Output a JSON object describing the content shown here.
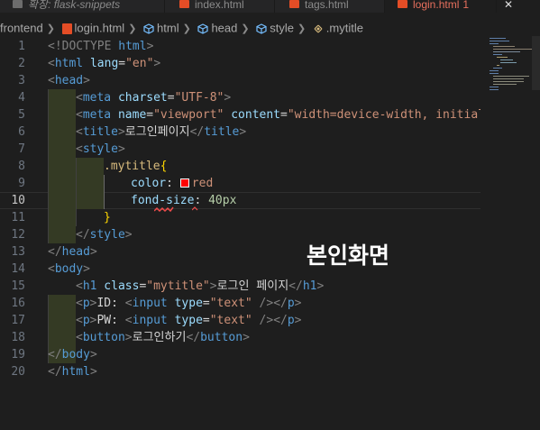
{
  "tabs": [
    {
      "label": "확장: flask-snippets",
      "icon": "extension-icon",
      "active": false
    },
    {
      "label": "index.html",
      "icon": "html5-icon",
      "active": false
    },
    {
      "label": "tags.html",
      "icon": "html5-icon",
      "active": false
    },
    {
      "label": "login.html",
      "icon": "html5-icon",
      "active": true,
      "modified": "1"
    }
  ],
  "breadcrumb": [
    "frontend",
    "login.html",
    "html",
    "head",
    "style",
    ".mytitle"
  ],
  "line_numbers": [
    "1",
    "2",
    "3",
    "4",
    "5",
    "6",
    "7",
    "8",
    "9",
    "10",
    "11",
    "12",
    "13",
    "14",
    "15",
    "16",
    "17",
    "18",
    "19",
    "20"
  ],
  "current_line": "10",
  "code": {
    "l1_a": "<!DOCTYPE ",
    "l1_b": "html",
    "l1_c": ">",
    "l2_a": "<",
    "l2_b": "html",
    "l2_c": " lang",
    "l2_d": "=",
    "l2_e": "\"en\"",
    "l2_f": ">",
    "l3_a": "<",
    "l3_b": "head",
    "l3_c": ">",
    "l4_a": "<",
    "l4_b": "meta",
    "l4_c": " charset",
    "l4_d": "=",
    "l4_e": "\"UTF-8\"",
    "l4_f": ">",
    "l5_a": "<",
    "l5_b": "meta",
    "l5_c": " name",
    "l5_d": "=",
    "l5_e": "\"viewport\"",
    "l5_f": " content",
    "l5_g": "=",
    "l5_h": "\"width=device-width, initial-",
    "l6_a": "<",
    "l6_b": "title",
    "l6_c": ">",
    "l6_d": "로그인페이지",
    "l6_e": "</",
    "l6_f": "title",
    "l6_g": ">",
    "l7_a": "<",
    "l7_b": "style",
    "l7_c": ">",
    "l8_a": ".mytitle",
    "l8_b": "{",
    "l9_a": "color",
    "l9_b": ": ",
    "l9_c": "red",
    "l10_a": "fond-size",
    "l10_b": ": ",
    "l10_c": "40px",
    "l11_a": "}",
    "l12_a": "</",
    "l12_b": "style",
    "l12_c": ">",
    "l13_a": "</",
    "l13_b": "head",
    "l13_c": ">",
    "l14_a": "<",
    "l14_b": "body",
    "l14_c": ">",
    "l15_a": "<",
    "l15_b": "h1",
    "l15_c": " class",
    "l15_d": "=",
    "l15_e": "\"mytitle\"",
    "l15_f": ">",
    "l15_g": "로그인 페이지",
    "l15_h": "</",
    "l15_i": "h1",
    "l15_j": ">",
    "l16_a": "<",
    "l16_b": "p",
    "l16_c": ">",
    "l16_d": "ID: ",
    "l16_e": "<",
    "l16_f": "input",
    "l16_g": " type",
    "l16_h": "=",
    "l16_i": "\"text\"",
    "l16_j": " />",
    "l16_k": "</",
    "l16_l": "p",
    "l16_m": ">",
    "l17_a": "<",
    "l17_b": "p",
    "l17_c": ">",
    "l17_d": "PW: ",
    "l17_e": "<",
    "l17_f": "input",
    "l17_g": " type",
    "l17_h": "=",
    "l17_i": "\"text\"",
    "l17_j": " />",
    "l17_k": "</",
    "l17_l": "p",
    "l17_m": ">",
    "l18_a": "<",
    "l18_b": "button",
    "l18_c": ">",
    "l18_d": "로그인하기",
    "l18_e": "</",
    "l18_f": "button",
    "l18_g": ">",
    "l19_a": "</",
    "l19_b": "body",
    "l19_c": ">",
    "l20_a": "</",
    "l20_b": "html",
    "l20_c": ">"
  },
  "overlay_text": "본인화면",
  "colors": {
    "swatch": "#ff0000",
    "active_tab": "#e8705e"
  }
}
